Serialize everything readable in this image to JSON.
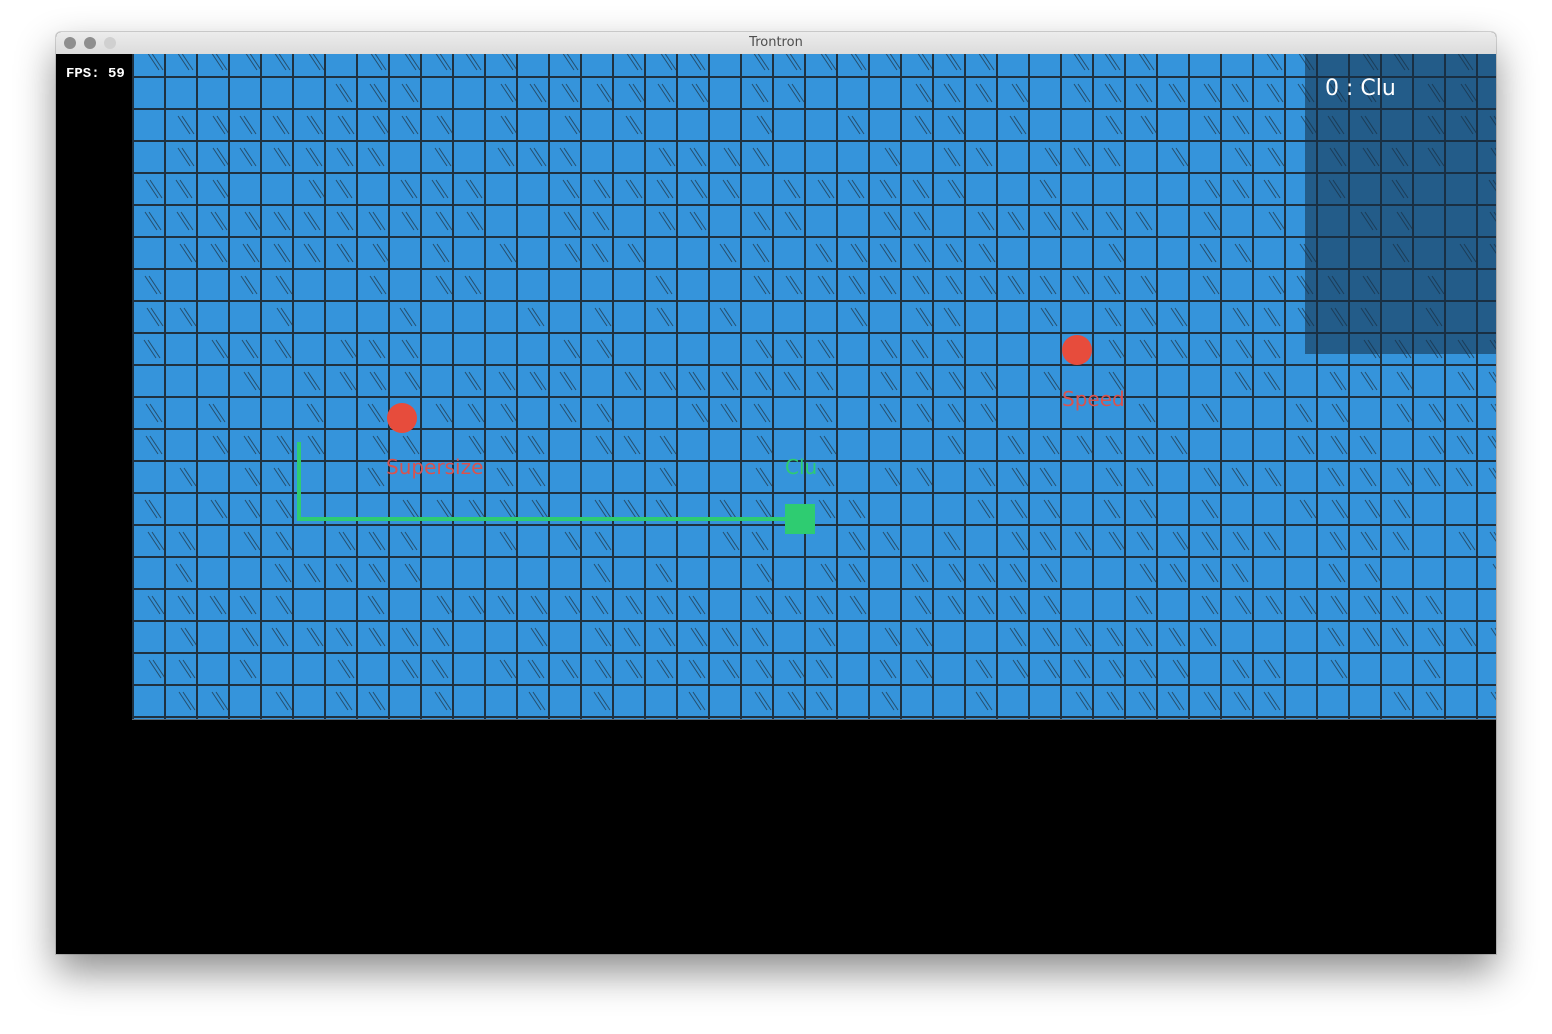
{
  "window": {
    "title": "Trontron"
  },
  "hud": {
    "fps_label": "FPS:",
    "fps_value": "59"
  },
  "scoreboard": {
    "entries": [
      {
        "score": "0",
        "separator": ":",
        "name": "Clu"
      }
    ]
  },
  "powerups": [
    {
      "label": "Supersize",
      "color": "#e74c3c"
    },
    {
      "label": "Speed",
      "color": "#e74c3c"
    }
  ],
  "players": [
    {
      "name": "Clu",
      "color": "#2ecc71"
    }
  ],
  "colors": {
    "board": "#3594db",
    "grid_line": "#1f3140",
    "player": "#2ecc71",
    "powerup": "#e74c3c",
    "background": "#000000"
  }
}
